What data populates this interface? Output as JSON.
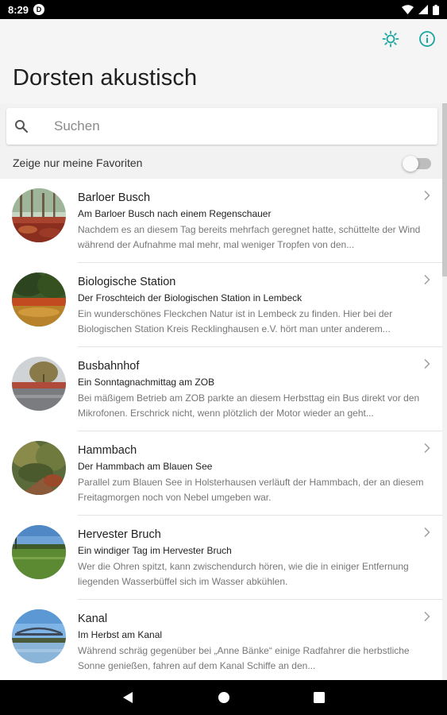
{
  "status_bar": {
    "time": "8:29",
    "notification_badge": "D"
  },
  "app": {
    "title": "Dorsten akustisch",
    "accent_color": "#1aa6a0"
  },
  "actions": {
    "brightness_icon": "brightness-icon",
    "info_icon": "info-icon"
  },
  "search": {
    "placeholder": "Suchen",
    "value": ""
  },
  "favorites": {
    "label": "Zeige nur meine Favoriten",
    "enabled": false
  },
  "items": [
    {
      "title": "Barloer Busch",
      "subtitle": "Am Barloer Busch nach einem Regenschauer",
      "description": "Nachdem es an diesem Tag bereits mehrfach geregnet hatte, schüttelte der Wind während der Aufnahme mal mehr, mal weniger Tropfen von den..."
    },
    {
      "title": "Biologische Station",
      "subtitle": "Der Froschteich der Biologischen Station in Lembeck",
      "description": "Ein wunderschönes Fleckchen Natur ist in Lembeck zu finden. Hier bei der Biologischen Station Kreis Recklinghausen e.V. hört man unter anderem..."
    },
    {
      "title": "Busbahnhof",
      "subtitle": "Ein Sonntagnachmittag am ZOB",
      "description": "Bei mäßigem Betrieb am ZOB parkte an diesem Herbsttag ein Bus direkt vor den Mikrofonen. Erschrick nicht, wenn plötzlich der Motor wieder an geht..."
    },
    {
      "title": "Hammbach",
      "subtitle": "Der Hammbach am Blauen See",
      "description": "Parallel zum Blauen See in Holsterhausen verläuft der Hammbach, der an diesem Freitagmorgen noch von Nebel umgeben war."
    },
    {
      "title": "Hervester Bruch",
      "subtitle": "Ein windiger Tag im Hervester Bruch",
      "description": "Wer die Ohren spitzt, kann zwischendurch hören, wie die in einiger Entfernung liegenden Wasserbüffel sich im Wasser abkühlen."
    },
    {
      "title": "Kanal",
      "subtitle": "Im Herbst am Kanal",
      "description": "Während schräg gegenüber bei „Anne Bänke“ einige Radfahrer die herbstliche Sonne genießen, fahren auf dem Kanal Schiffe an den..."
    }
  ]
}
